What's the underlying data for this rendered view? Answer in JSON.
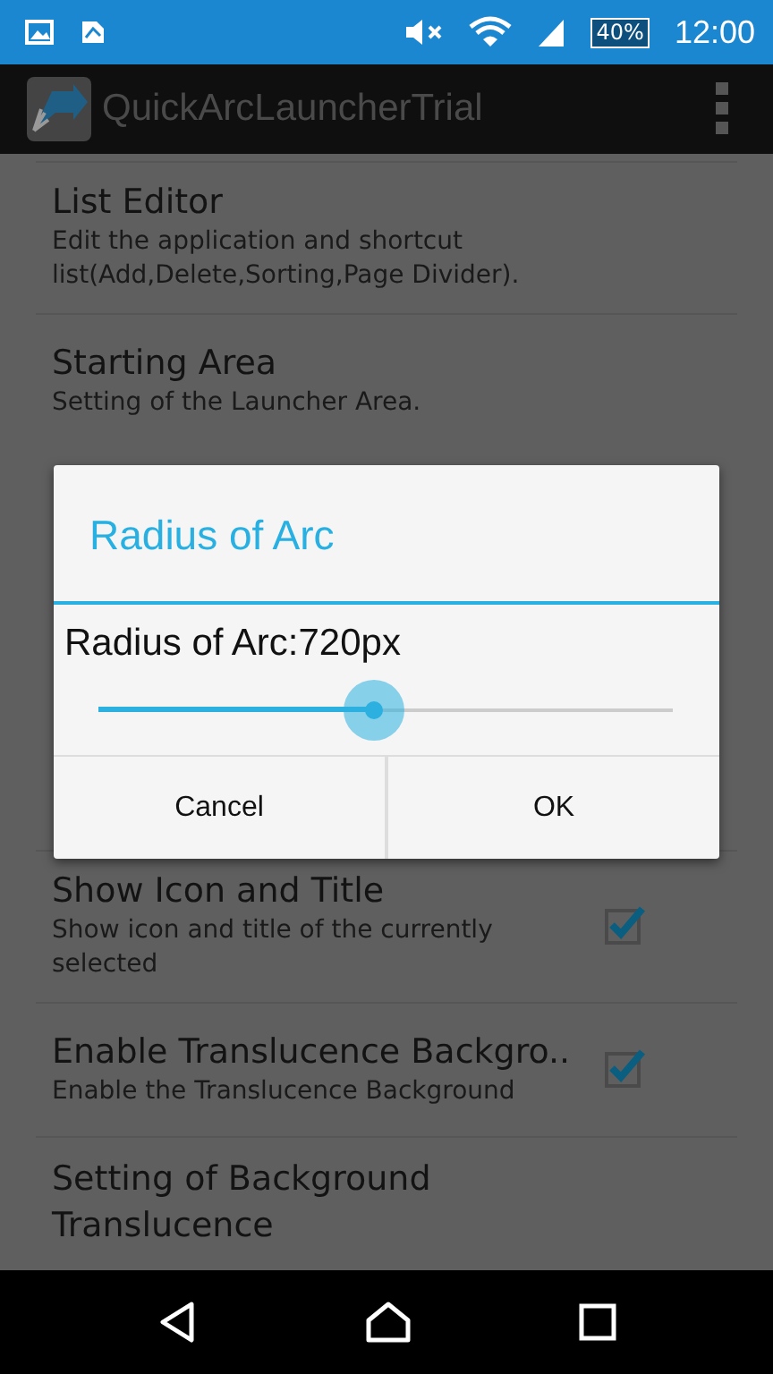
{
  "status_bar": {
    "battery": "40%",
    "time": "12:00"
  },
  "action_bar": {
    "title": "QuickArcLauncherTrial"
  },
  "settings_above": [
    {
      "title": "List Editor",
      "summary": "Edit the application and shortcut list(Add,Delete,Sorting,Page Divider)."
    },
    {
      "title": "Starting Area",
      "summary": "Setting of the Launcher Area."
    }
  ],
  "settings_below": [
    {
      "kind": "checkbox",
      "title": "Show Icon and Title",
      "summary": "Show icon and title of the currently selected",
      "checked": true
    },
    {
      "kind": "checkbox",
      "title": "Enable Translucence Backgro..",
      "summary": "Enable the Translucence Background",
      "checked": true
    },
    {
      "kind": "plain",
      "title": "Setting of Background Translucence"
    }
  ],
  "dialog": {
    "title": "Radius of Arc",
    "value_label": "Radius of Arc:720px",
    "slider": {
      "level": 0.48
    },
    "buttons": [
      "Cancel",
      "OK"
    ]
  }
}
